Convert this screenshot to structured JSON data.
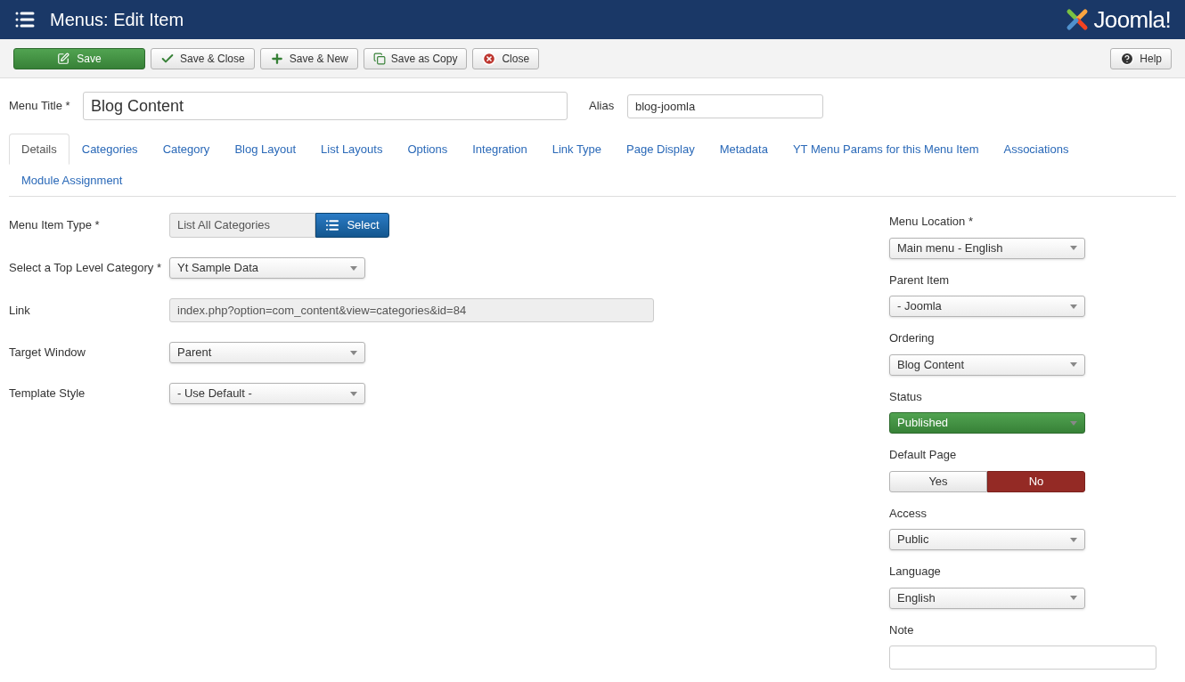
{
  "header": {
    "title": "Menus: Edit Item",
    "logo_text": "Joomla!"
  },
  "toolbar": {
    "buttons": [
      {
        "label": "Save",
        "kind": "primary"
      },
      {
        "label": "Save & Close",
        "kind": "default"
      },
      {
        "label": "Save & New",
        "kind": "default"
      },
      {
        "label": "Save as Copy",
        "kind": "default"
      },
      {
        "label": "Close",
        "kind": "default"
      }
    ],
    "help": {
      "label": "Help"
    }
  },
  "title_field": {
    "label": "Menu Title *",
    "value": "Blog Content"
  },
  "alias_field": {
    "label": "Alias",
    "value": "blog-joomla"
  },
  "tabs": [
    {
      "label": "Details",
      "selected": true
    },
    {
      "label": "Categories",
      "selected": false
    },
    {
      "label": "Category",
      "selected": false
    },
    {
      "label": "Blog Layout",
      "selected": false
    },
    {
      "label": "List Layouts",
      "selected": false
    },
    {
      "label": "Options",
      "selected": false
    },
    {
      "label": "Integration",
      "selected": false
    },
    {
      "label": "Link Type",
      "selected": false
    },
    {
      "label": "Page Display",
      "selected": false
    },
    {
      "label": "Metadata",
      "selected": false
    },
    {
      "label": "YT Menu Params for this Menu Item",
      "selected": false
    },
    {
      "label": "Associations",
      "selected": false
    },
    {
      "label": "Module Assignment",
      "selected": false
    }
  ],
  "main_fields": [
    {
      "kind": "picker",
      "label": "Menu Item Type *",
      "value": "List All Categories",
      "button": "Select"
    },
    {
      "kind": "select",
      "label": "Select a Top Level Category *",
      "value": "Yt Sample Data"
    },
    {
      "kind": "readonly",
      "label": "Link",
      "value": "index.php?option=com_content&view=categories&id=84"
    },
    {
      "kind": "select",
      "label": "Target Window",
      "value": "Parent"
    },
    {
      "kind": "select",
      "label": "Template Style",
      "value": "- Use Default -"
    }
  ],
  "side_fields": [
    {
      "kind": "select",
      "label": "Menu Location *",
      "value": "Main menu - English"
    },
    {
      "kind": "select",
      "label": "Parent Item",
      "value": "- Joomla"
    },
    {
      "kind": "select",
      "label": "Ordering",
      "value": "Blog Content"
    },
    {
      "kind": "status",
      "label": "Status",
      "value": "Published"
    },
    {
      "kind": "toggle",
      "label": "Default Page",
      "options": [
        {
          "label": "Yes",
          "selected": false
        },
        {
          "label": "No",
          "selected": true
        }
      ]
    },
    {
      "kind": "select",
      "label": "Access",
      "value": "Public"
    },
    {
      "kind": "select",
      "label": "Language",
      "value": "English"
    },
    {
      "kind": "text",
      "label": "Note"
    }
  ]
}
